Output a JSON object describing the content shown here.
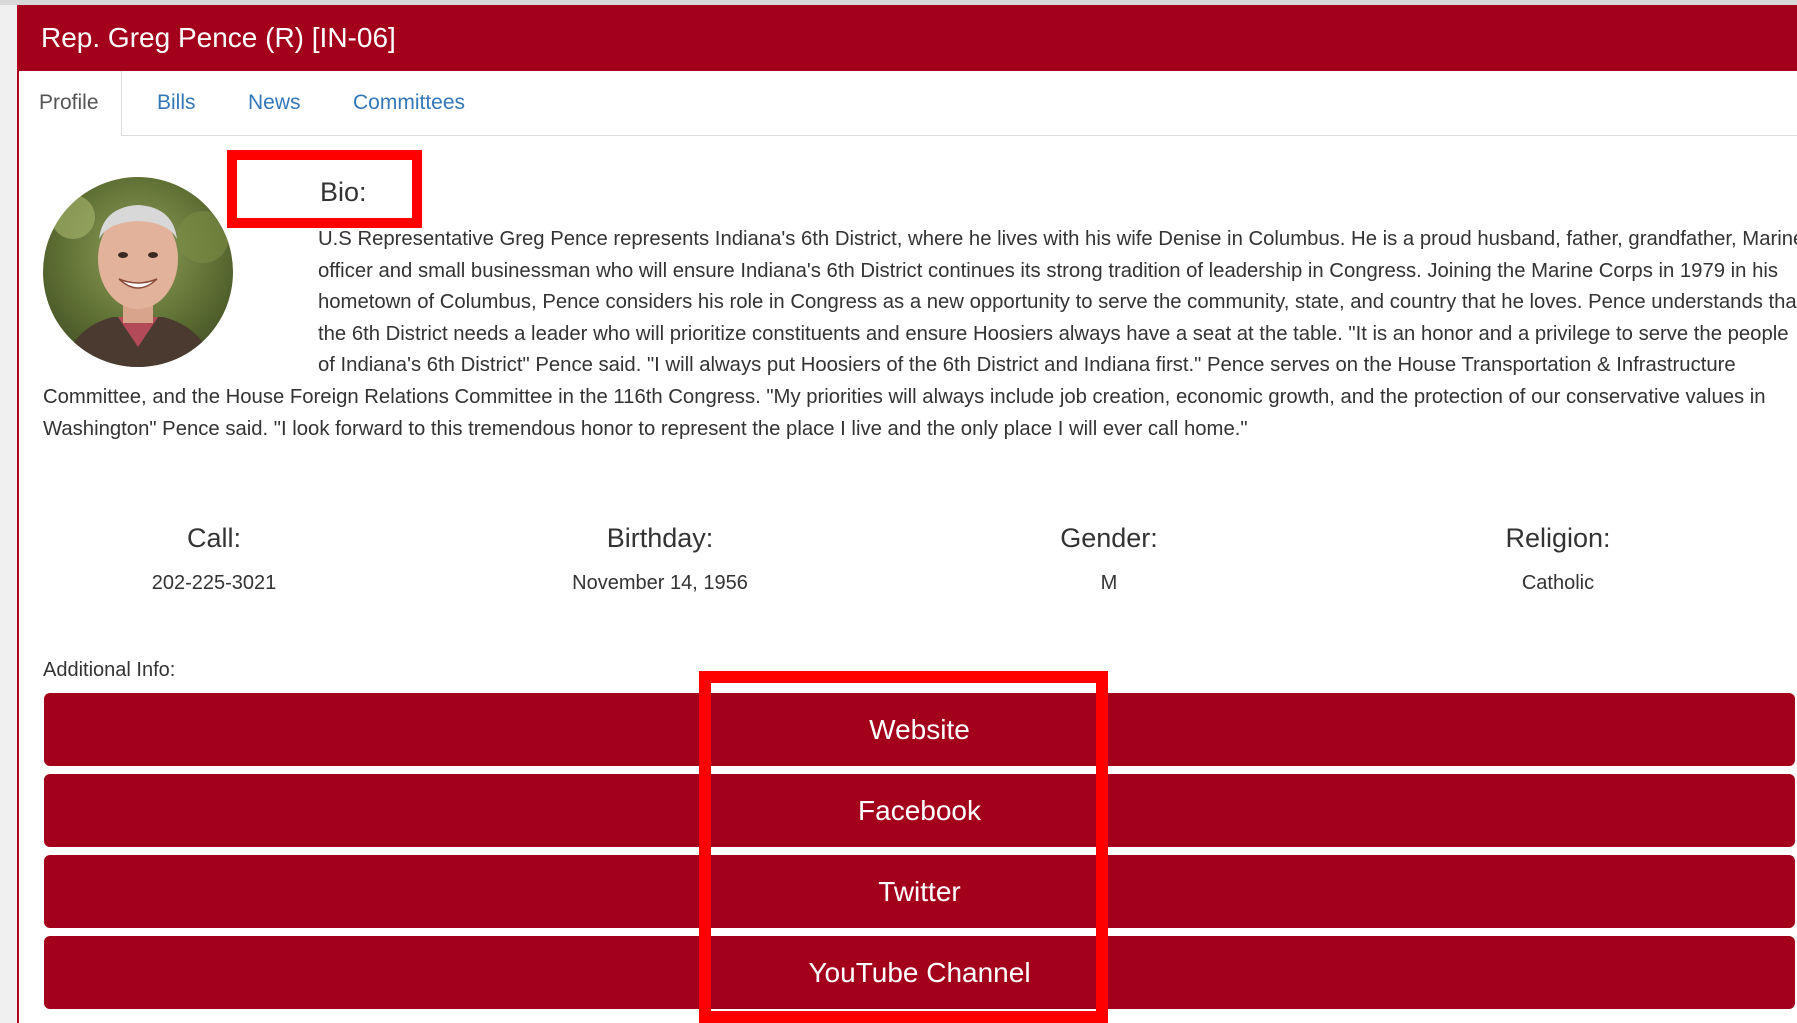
{
  "header": {
    "title": "Rep. Greg Pence (R) [IN-06]"
  },
  "tabs": [
    {
      "label": "Profile"
    },
    {
      "label": "Bills"
    },
    {
      "label": "News"
    },
    {
      "label": "Committees"
    }
  ],
  "profile": {
    "bio_label": "Bio:",
    "bio_text": "U.S Representative Greg Pence represents Indiana's 6th District, where he lives with his wife Denise in Columbus. He is a proud husband, father, grandfather, Marine officer and small businessman who will ensure Indiana's 6th District continues its strong tradition of leadership in Congress. Joining the Marine Corps in 1979 in his hometown of Columbus, Pence considers his role in Congress as a new opportunity to serve the community, state, and country that he loves. Pence understands that the 6th District needs a leader who will prioritize constituents and ensure Hoosiers always have a seat at the table. \"It is an honor and a privilege to serve the people of Indiana's 6th District\" Pence said. \"I will always put Hoosiers of the 6th District and Indiana first.\" Pence serves on the House Transportation & Infrastructure Committee, and the House Foreign Relations Committee in the 116th Congress. \"My priorities will always include job creation, economic growth, and the protection of our conservative values in Washington\" Pence said. \"I look forward to this tremendous honor to represent the place I live and the only place I will ever call home.\"",
    "stats": [
      {
        "label": "Call:",
        "value": "202-225-3021"
      },
      {
        "label": "Birthday:",
        "value": "November 14, 1956"
      },
      {
        "label": "Gender:",
        "value": "M"
      },
      {
        "label": "Religion:",
        "value": "Catholic"
      }
    ],
    "additional_info_label": "Additional Info:",
    "links": [
      {
        "label": "Website"
      },
      {
        "label": "Facebook"
      },
      {
        "label": "Twitter"
      },
      {
        "label": "YouTube Channel"
      }
    ]
  },
  "colors": {
    "header_bg": "#a3001b",
    "link_color": "#3477b8",
    "highlight": "#ff0000"
  }
}
